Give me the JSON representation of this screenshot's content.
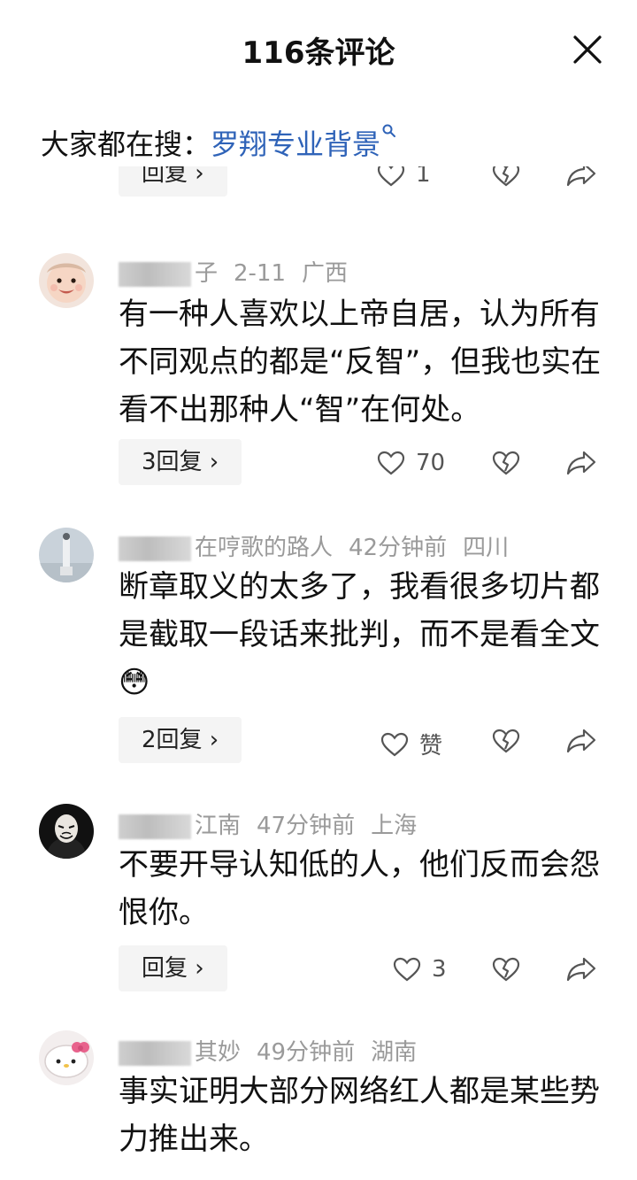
{
  "header": {
    "title": "116条评论"
  },
  "search": {
    "label": "大家都在搜：",
    "keyword": "罗翔专业背景"
  },
  "partial": {
    "reply_label": "回复 ›",
    "like_count": "1"
  },
  "comments": [
    {
      "name_visible": "子",
      "time": "2-11",
      "location": "广西",
      "text": "有一种人喜欢以上帝自居，认为所有不同观点的都是“反智”，但我也实在看不出那种人“智”在何处。",
      "reply_label": "3回复 ›",
      "like_count": "70"
    },
    {
      "name_visible": "在哼歌的路人",
      "time": "42分钟前",
      "location": "四川",
      "text": "断章取义的太多了，我看很多切片都是截取一段话来批判，而不是看全文",
      "emoji": "😳",
      "reply_label": "2回复 ›",
      "like_count": "赞"
    },
    {
      "name_visible": "江南",
      "time": "47分钟前",
      "location": "上海",
      "text": "不要开导认知低的人，他们反而会怨恨你。",
      "reply_label": "回复 ›",
      "like_count": "3"
    },
    {
      "name_visible": "其妙",
      "time": "49分钟前",
      "location": "湖南",
      "text": "事实证明大部分网络红人都是某些势力推出来。"
    }
  ],
  "colors": {
    "link": "#2f63b8",
    "meta": "#9a9a9a",
    "reply_bg": "#f4f4f4"
  }
}
